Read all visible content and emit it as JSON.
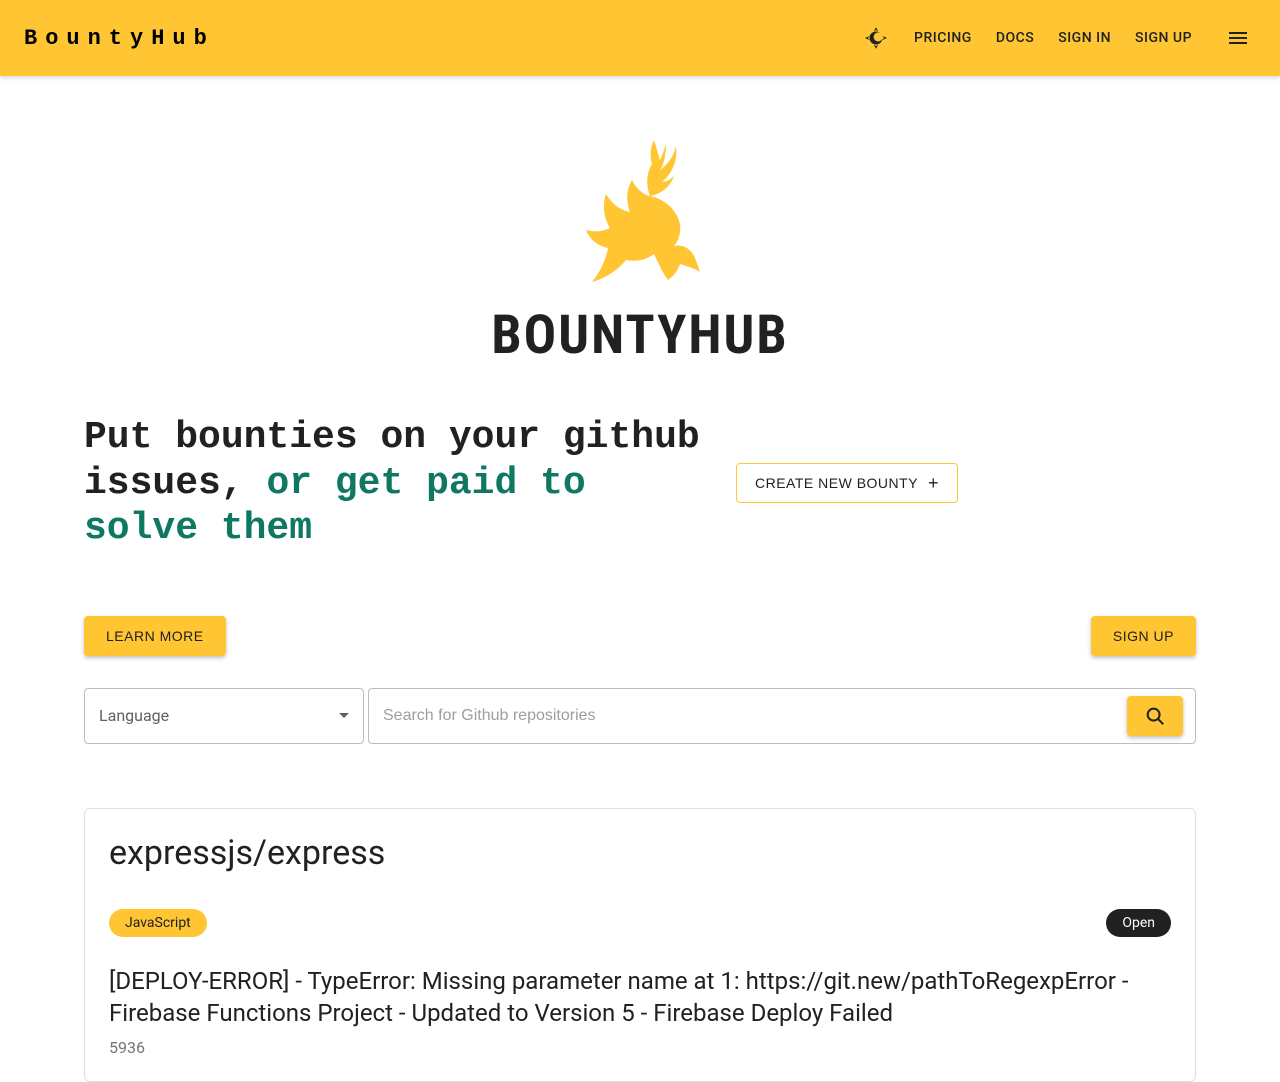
{
  "header": {
    "brand": "BountyHub",
    "nav": {
      "pricing": "PRICING",
      "docs": "DOCS",
      "signin": "SIGN IN",
      "signup": "SIGN UP"
    }
  },
  "hero": {
    "title": "BOUNTYHUB",
    "tagline_plain": "Put bounties on your github issues, ",
    "tagline_accent": "or get paid to solve them",
    "create_bounty": "CREATE NEW BOUNTY"
  },
  "cta": {
    "learn_more": "LEARN MORE",
    "sign_up": "SIGN UP"
  },
  "search": {
    "language_label": "Language",
    "placeholder": "Search for Github repositories"
  },
  "card": {
    "repo": "expressjs/express",
    "language": "JavaScript",
    "status": "Open",
    "issue_title": "[DEPLOY-ERROR] - TypeError: Missing parameter name at 1: https://git.new/pathToRegexpError - Firebase Functions Project - Updated to Version 5 - Firebase Deploy Failed",
    "issue_number": "5936"
  },
  "colors": {
    "primary": "#ffc533",
    "accent_text": "#0f7863"
  }
}
